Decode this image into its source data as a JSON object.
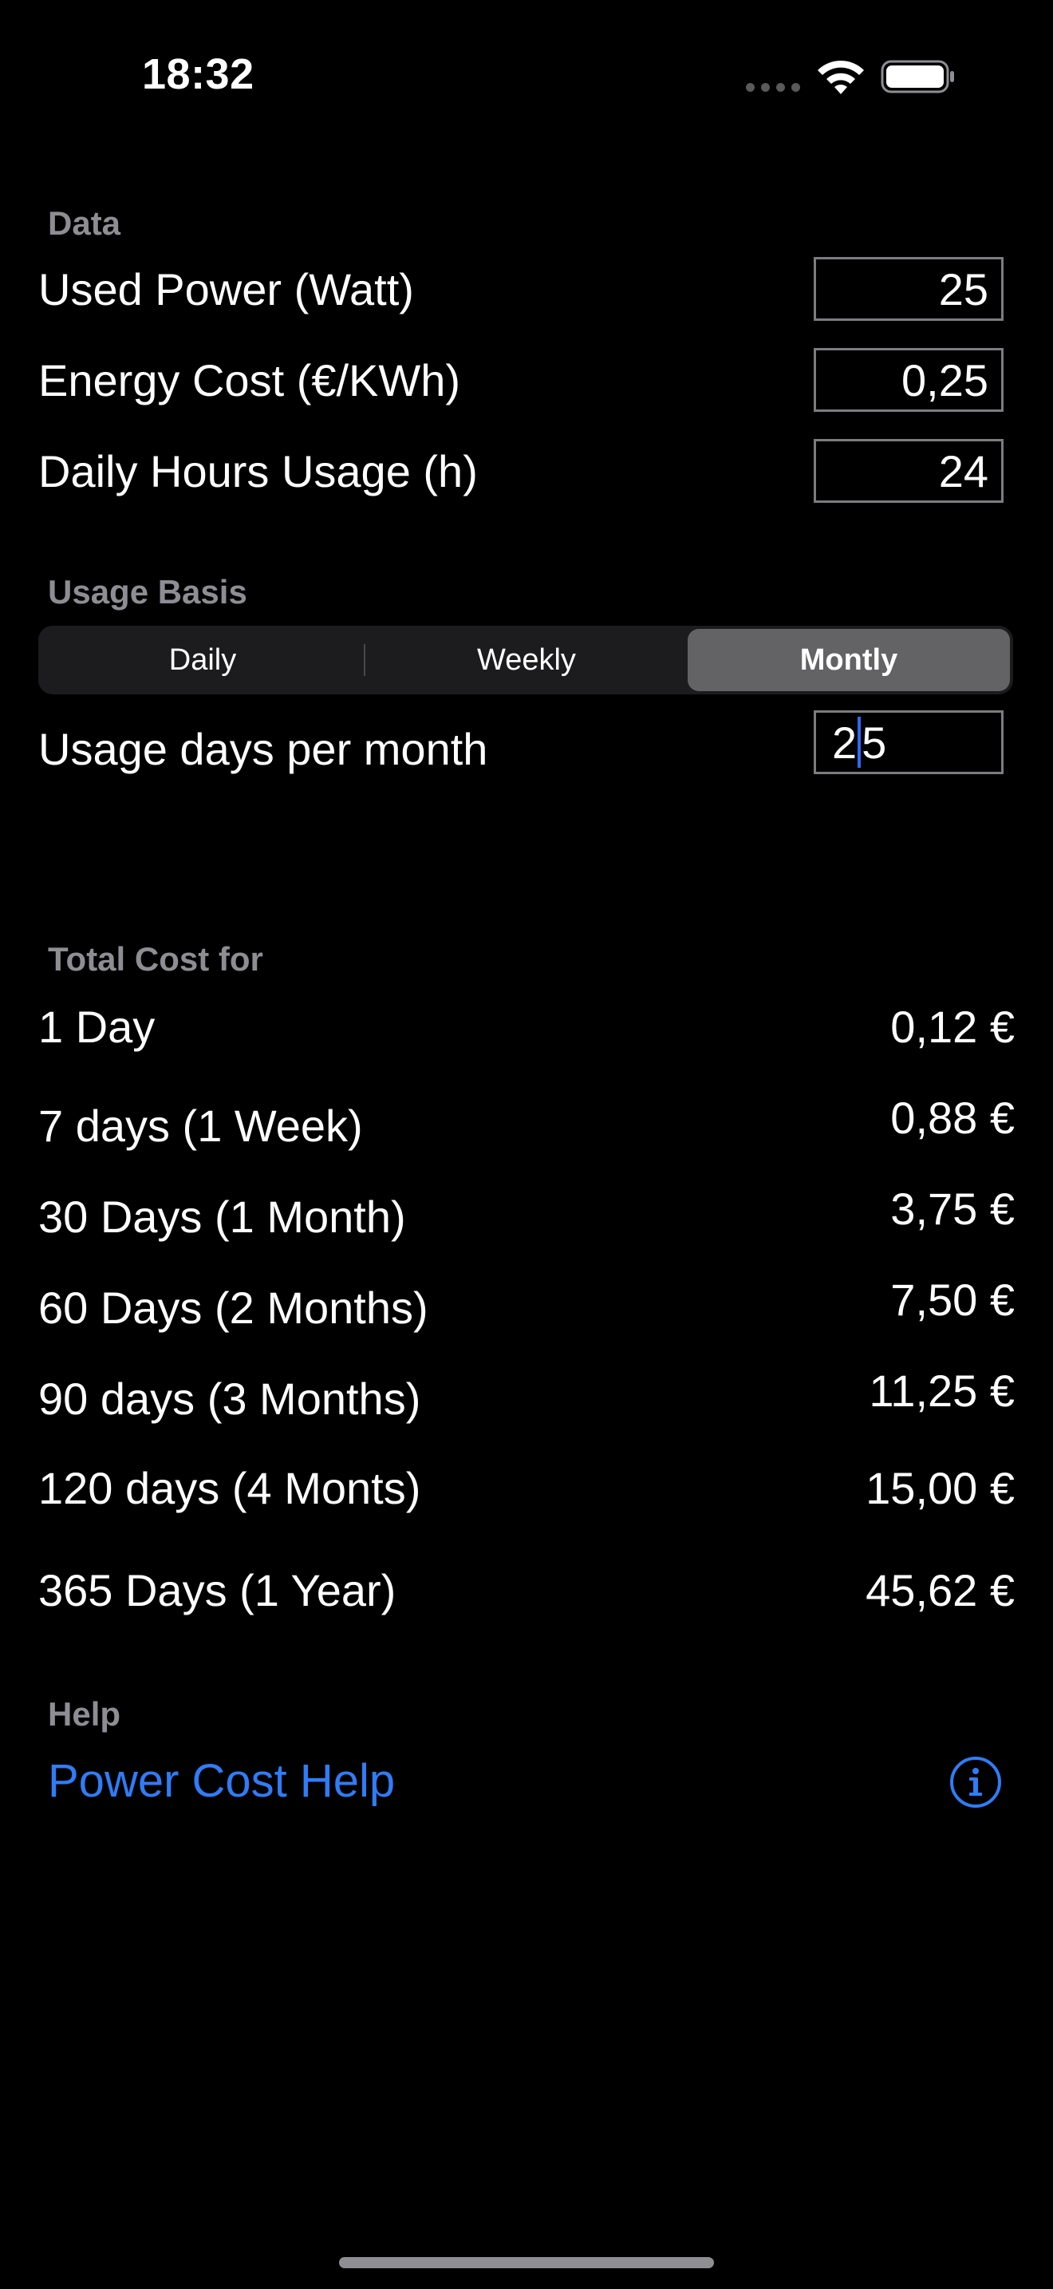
{
  "status_bar": {
    "time": "18:32",
    "icons": [
      "signal-dots-icon",
      "wifi-icon",
      "battery-icon"
    ]
  },
  "data_section": {
    "header": "Data",
    "rows": [
      {
        "label": "Used Power (Watt)",
        "value": "25"
      },
      {
        "label": "Energy Cost (€/KWh)",
        "value": "0,25"
      },
      {
        "label": "Daily Hours Usage (h)",
        "value": "24"
      }
    ]
  },
  "usage_section": {
    "header": "Usage Basis",
    "segments": [
      "Daily",
      "Weekly",
      "Montly"
    ],
    "selected_segment": "Montly",
    "days_label": "Usage days per month",
    "days_value_before_cursor": "2",
    "days_value_after_cursor": "5"
  },
  "total_section": {
    "header": "Total Cost for",
    "rows": [
      {
        "label": "1 Day",
        "value": "0,12 €"
      },
      {
        "label": "7 days (1 Week)",
        "value": "0,88 €"
      },
      {
        "label": "30 Days (1 Month)",
        "value": "3,75 €"
      },
      {
        "label": "60 Days (2 Months)",
        "value": "7,50 €"
      },
      {
        "label": "90 days (3 Months)",
        "value": "11,25 €"
      },
      {
        "label": "120 days (4 Monts)",
        "value": "15,00 €"
      },
      {
        "label": "365 Days (1 Year)",
        "value": "45,62 €"
      }
    ]
  },
  "help_section": {
    "header": "Help",
    "link": "Power Cost Help"
  },
  "colors": {
    "background": "#000000",
    "accent": "#2f7cf6",
    "section_header": "#8d8d93",
    "segment_selected": "#636366"
  }
}
